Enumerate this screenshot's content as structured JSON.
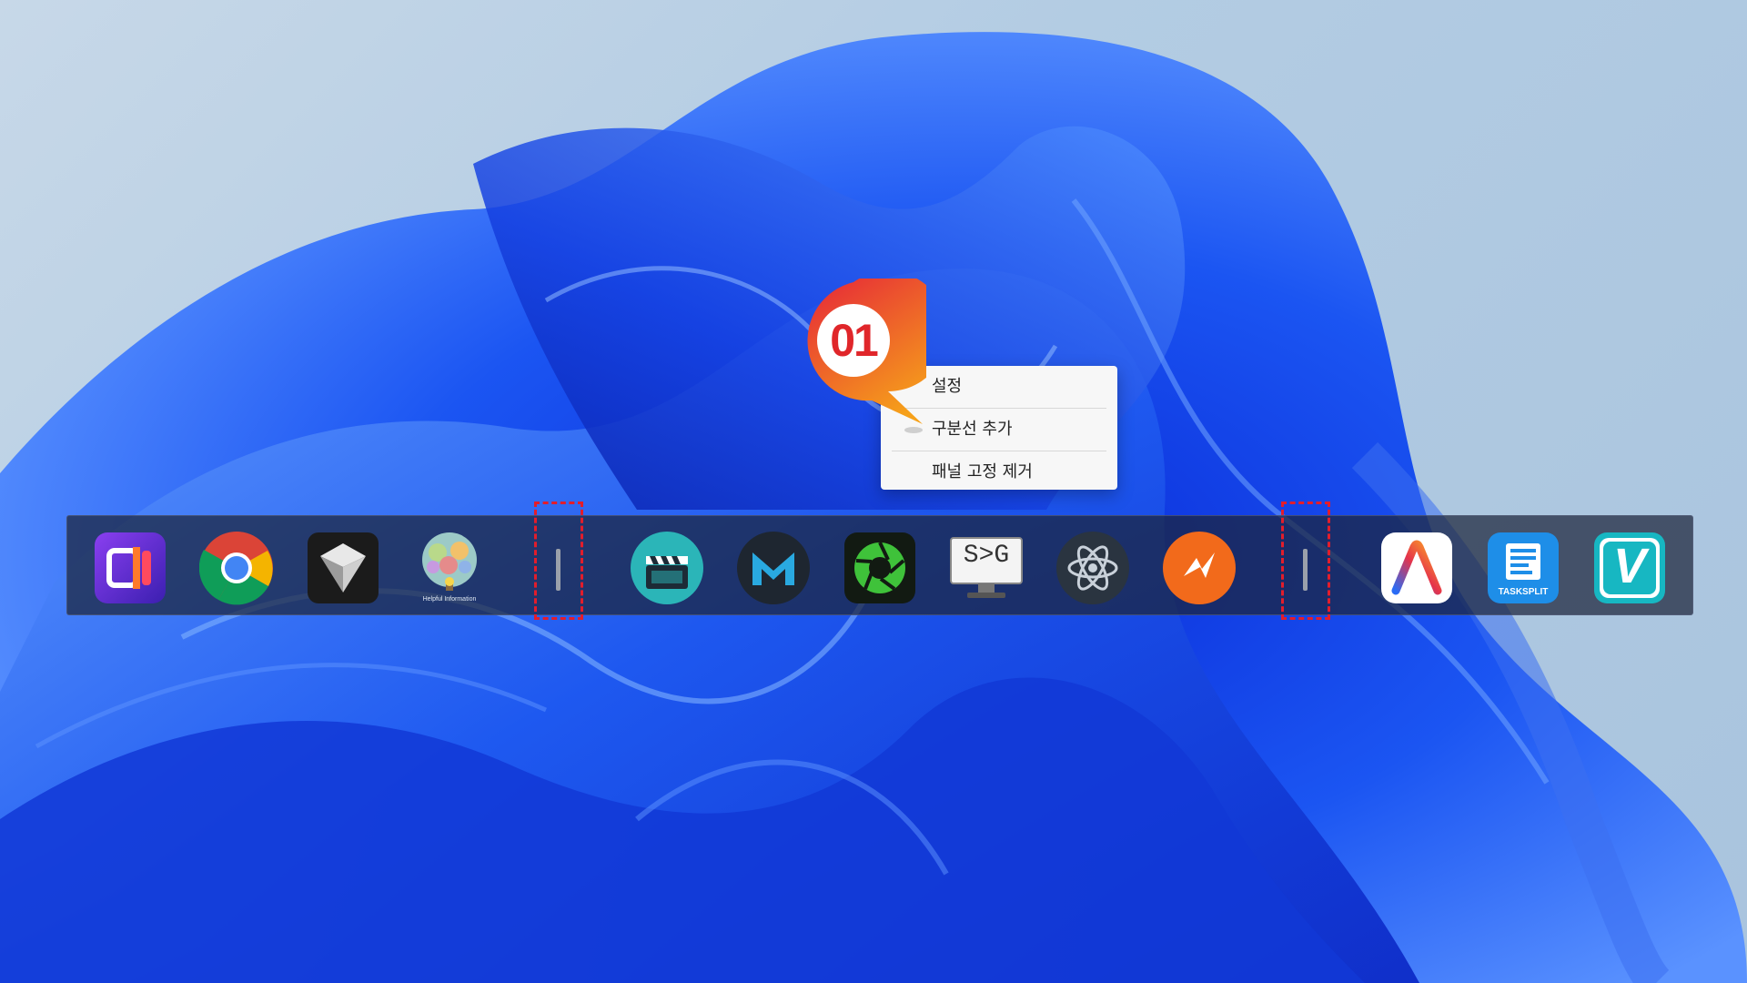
{
  "context_menu": {
    "items": [
      {
        "label": "설정"
      },
      {
        "label": "구분선 추가"
      },
      {
        "label": "패널 고정 제거"
      }
    ]
  },
  "callout": {
    "label": "01"
  },
  "dock": {
    "apps": [
      {
        "icon": "purple-split-app-icon"
      },
      {
        "icon": "chrome-icon"
      },
      {
        "icon": "cube-app-icon"
      },
      {
        "icon": "helpful-information-tree-icon",
        "caption": "Helpful Information"
      },
      {
        "icon": "clapperboard-icon"
      },
      {
        "icon": "m-logo-icon"
      },
      {
        "icon": "aperture-icon"
      },
      {
        "icon": "s-to-g-monitor-icon",
        "label": "S>G"
      },
      {
        "icon": "atom-icon"
      },
      {
        "icon": "orange-bolt-icon"
      },
      {
        "icon": "arc-a-icon"
      },
      {
        "icon": "tasksplit-icon",
        "caption": "TASKSPLIT"
      },
      {
        "icon": "v-logo-icon",
        "label": "V"
      }
    ]
  },
  "colors": {
    "highlight": "#e31d2b",
    "callout_gradient_start": "#e5213a",
    "callout_gradient_end": "#f6a11a",
    "dock_background": "#1c243a"
  }
}
